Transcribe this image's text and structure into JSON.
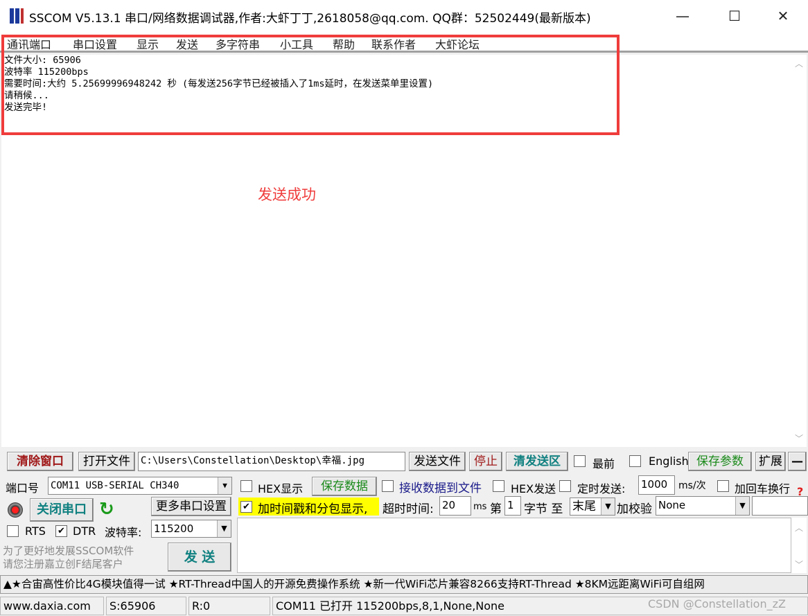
{
  "window": {
    "title": "SSCOM V5.13.1 串口/网络数据调试器,作者:大虾丁丁,2618058@qq.com. QQ群：52502449(最新版本)",
    "minimize": "—",
    "maximize": "☐",
    "close": "✕"
  },
  "menu": [
    "通讯端口",
    "串口设置",
    "显示",
    "发送",
    "多字符串",
    "小工具",
    "帮助",
    "联系作者",
    "大虾论坛"
  ],
  "output_lines": [
    "文件大小: 65906",
    "波特率 115200bps",
    "需要时间:大约 5.25699996948242 秒 (每发送256字节已经被插入了1ms延时，在发送菜单里设置)",
    "请稍候...",
    "发送完毕!"
  ],
  "annotation": "发送成功",
  "colors": {
    "annotation": "#f03c3c",
    "highlight": "#ffff00"
  },
  "toolbar": {
    "clear": "清除窗口",
    "open_file": "打开文件",
    "file_path": "C:\\Users\\Constellation\\Desktop\\幸福.jpg",
    "send_file": "发送文件",
    "stop": "停止",
    "clear_send": "清发送区",
    "topmost": "最前",
    "english": "English",
    "save_params": "保存参数",
    "expand": "扩展",
    "collapse": "—"
  },
  "port": {
    "label": "端口号",
    "value": "COM11 USB-SERIAL CH340",
    "close_port": "关闭串口",
    "more_settings": "更多串口设置",
    "rts": "RTS",
    "dtr": "DTR",
    "rts_checked": false,
    "dtr_checked": true,
    "baud_label": "波特率:",
    "baud": "115200",
    "promo1": "为了更好地发展SSCOM软件",
    "promo2": "请您注册嘉立创F结尾客户",
    "send": "发  送"
  },
  "options": {
    "hex_display": "HEX显示",
    "save_data": "保存数据",
    "recv_to_file": "接收数据到文件",
    "hex_send": "HEX发送",
    "timed_send": "定时发送:",
    "interval": "1000",
    "interval_unit": "ms/次",
    "add_crlf": "加回车换行",
    "timestamp": "加时间戳和分包显示,",
    "timestamp_checked": true,
    "timeout_label": "超时时间:",
    "timeout": "20",
    "timeout_unit": "ms",
    "byte_prefix": "第",
    "byte_from": "1",
    "byte_suffix": "字节 至",
    "byte_to": "末尾",
    "checksum_label": "加校验",
    "checksum": "None",
    "help": "?"
  },
  "ticker": "▲★合宙高性价比4G模块值得一试 ★RT-Thread中国人的开源免费操作系统 ★新一代WiFi芯片兼容8266支持RT-Thread ★8KM远距离WiFi可自组网",
  "status": {
    "site": "www.daxia.com",
    "sent": "S:65906",
    "received": "R:0",
    "port_state": "COM11 已打开  115200bps,8,1,None,None",
    "watermark": "CSDN @Constellation_zZ"
  }
}
